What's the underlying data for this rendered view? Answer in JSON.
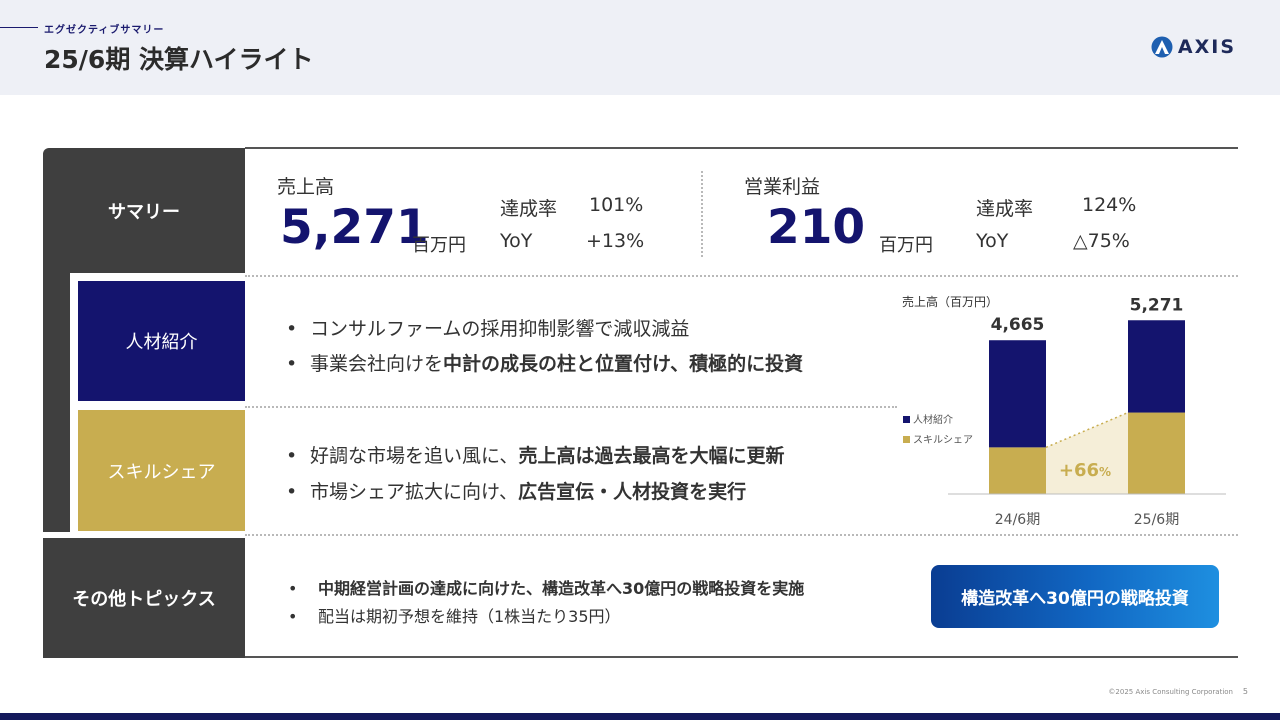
{
  "header": {
    "subtitle": "エグゼクティブサマリー",
    "title": "25/6期 決算ハイライト",
    "logo_text": "AXIS"
  },
  "sections": {
    "summary_label": "サマリー",
    "jinzai_label": "人材紹介",
    "skill_label": "スキルシェア",
    "topics_label": "その他トピックス"
  },
  "summary": {
    "sales": {
      "label": "売上高",
      "value": "5,271",
      "unit": "百万円",
      "achievement_label": "達成率",
      "achievement_value": "101%",
      "yoy_label": "YoY",
      "yoy_value": "+13%"
    },
    "profit": {
      "label": "営業利益",
      "value": "210",
      "unit": "百万円",
      "achievement_label": "達成率",
      "achievement_value": "124%",
      "yoy_label": "YoY",
      "yoy_value": "△75%"
    }
  },
  "jinzai": {
    "bullet": "•",
    "line1": "コンサルファームの採用抑制影響で減収減益",
    "line2_normal": "事業会社向けを",
    "line2_bold": "中計の成長の柱と位置付け、積極的に投資"
  },
  "skill": {
    "bullet": "•",
    "line1_normal": "好調な市場を追い風に、",
    "line1_bold": "売上高は過去最高を大幅に更新",
    "line2_normal": "市場シェア拡大に向け、",
    "line2_bold": "広告宣伝・人材投資を実行"
  },
  "topics": {
    "bullet": "•",
    "line1": "中期経営計画の達成に向けた、構造改革へ30億円の戦略投資を実施",
    "line2": "配当は期初予想を維持（1株当たり35円）",
    "pill": "構造改革へ30億円の戦略投資"
  },
  "chart_data": {
    "type": "bar",
    "title": "売上高（百万円）",
    "categories": [
      "24/6期",
      "25/6期"
    ],
    "totals": [
      "4,665",
      "5,271"
    ],
    "total_values": [
      4665,
      5271
    ],
    "series": [
      {
        "name": "人材紹介",
        "color": "#14146e",
        "values": [
          3250,
          2800
        ]
      },
      {
        "name": "スキルシェア",
        "color": "#c8ad50",
        "values": [
          1415,
          2471
        ]
      }
    ],
    "growth_label": "+66",
    "growth_suffix": "%",
    "growth_color": "#c8ad50",
    "ylim": [
      0,
      5400
    ]
  },
  "footer": {
    "copyright": "©2025 Axis Consulting Corporation",
    "page": "5"
  },
  "colors": {
    "navy": "#14146e",
    "gold": "#c8ad50",
    "dark": "#3f3f3f"
  }
}
